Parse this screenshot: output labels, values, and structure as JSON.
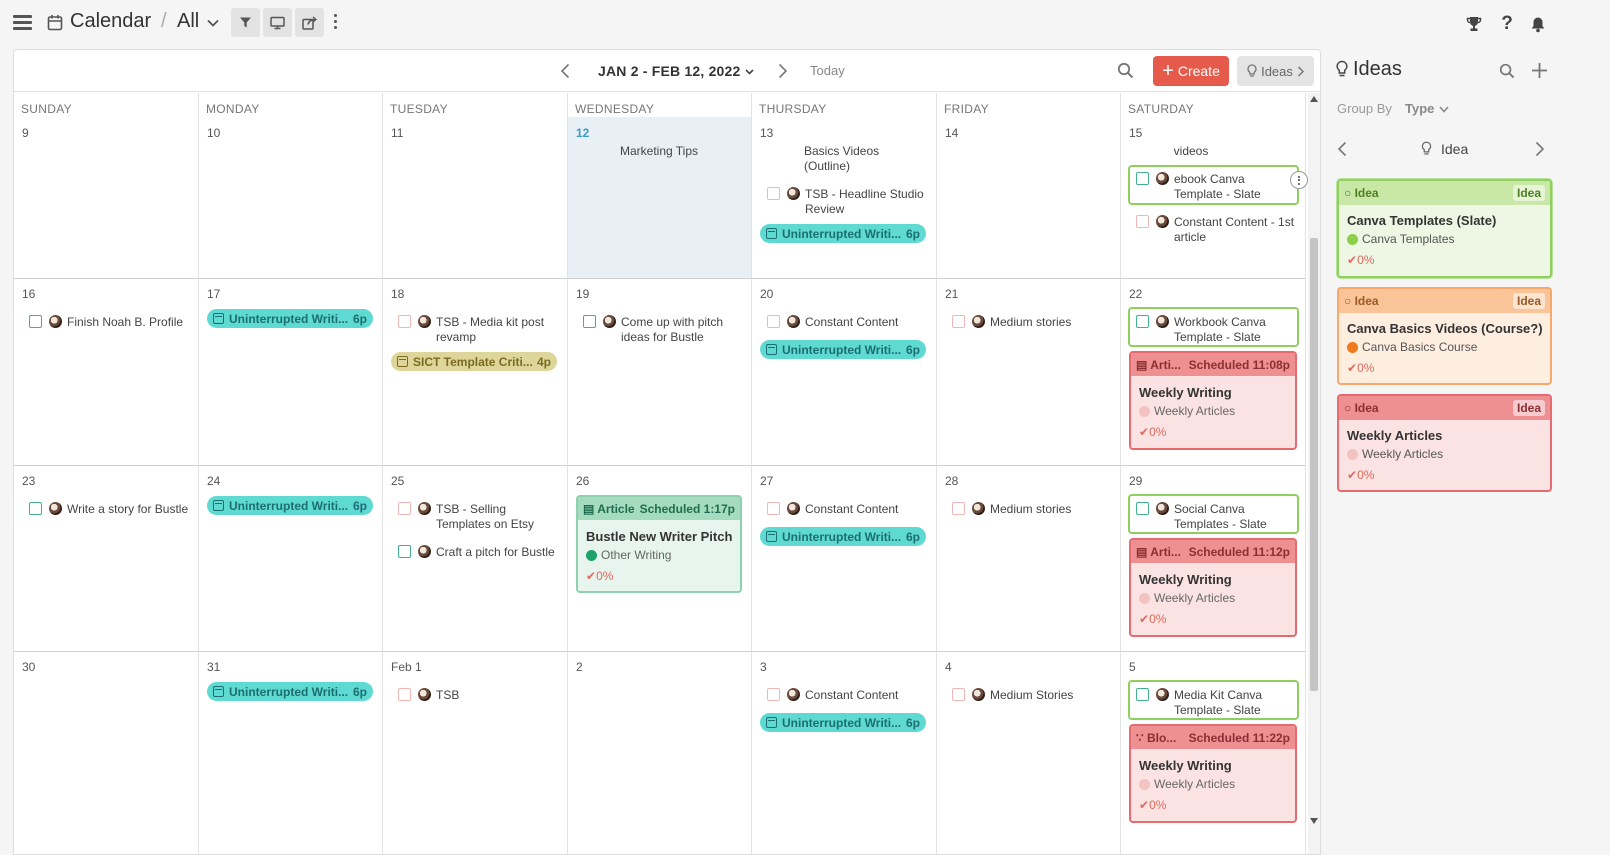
{
  "header": {
    "title": "Calendar",
    "separator": "/",
    "view": "All"
  },
  "toolbar": {
    "range": "JAN 2 - FEB 12, 2022",
    "today": "Today",
    "create": "Create",
    "ideas": "Ideas"
  },
  "days": [
    "SUNDAY",
    "MONDAY",
    "TUESDAY",
    "WEDNESDAY",
    "THURSDAY",
    "FRIDAY",
    "SATURDAY"
  ],
  "weeks": [
    [
      "9",
      "10",
      "11",
      "12",
      "13",
      "14",
      "15"
    ],
    [
      "16",
      "17",
      "18",
      "19",
      "20",
      "21",
      "22"
    ],
    [
      "23",
      "24",
      "25",
      "26",
      "27",
      "28",
      "29"
    ],
    [
      "30",
      "31",
      "Feb 1",
      "2",
      "3",
      "4",
      "5"
    ]
  ],
  "items": {
    "marketing_tips": "Marketing Tips",
    "basics_videos": "Basics Videos (Outline)",
    "tsb_headline": "TSB - Headline Studio Review",
    "uninterrupted": "Uninterrupted Writi...",
    "uninterrupted_time": "6p",
    "videos": "videos",
    "ebook_canva": "ebook Canva Template - Slate",
    "constant_1st": "Constant Content - 1st article",
    "finish_noah": "Finish Noah B. Profile",
    "tsb_media": "TSB - Media kit post revamp",
    "sict": "SICT Template Criti...",
    "sict_time": "4p",
    "come_up": "Come up with pitch ideas for Bustle",
    "constant": "Constant Content",
    "medium": "Medium stories",
    "medium_cap": "Medium Stories",
    "workbook": "Workbook Canva Template - Slate",
    "write_story": "Write a story for Bustle",
    "tsb_selling": "TSB - Selling Templates on Etsy",
    "craft_pitch": "Craft a pitch for Bustle",
    "social": "Social Canva Templates - Slate",
    "tsb": "TSB",
    "media_kit": "Media Kit Canva Template - Slate"
  },
  "cards": {
    "arti_type": "Arti...",
    "blo_type": "Blo...",
    "article_type": "Article",
    "sched_1108": "Scheduled 11:08p",
    "sched_1112": "Scheduled 11:12p",
    "sched_1122": "Scheduled 11:22p",
    "sched_117": "Scheduled 1:17p",
    "weekly_writing": "Weekly Writing",
    "weekly_articles": "Weekly Articles",
    "bustle_pitch": "Bustle New Writer Pitch",
    "other_writing": "Other Writing",
    "progress": "0%"
  },
  "sidebar": {
    "title": "Ideas",
    "group_by_label": "Group By",
    "group_by_value": "Type",
    "nav_label": "Idea",
    "ideas": [
      {
        "tag": "Idea",
        "badge": "Idea",
        "title": "Canva Templates (Slate)",
        "sub": "Canva Templates",
        "progress": "0%",
        "color": "#8fcf5f"
      },
      {
        "tag": "Idea",
        "badge": "Idea",
        "title": "Canva Basics Videos (Course?)",
        "sub": "Canva Basics Course",
        "progress": "0%",
        "color": "#f7a86a"
      },
      {
        "tag": "Idea",
        "badge": "Idea",
        "title": "Weekly Articles",
        "sub": "Weekly Articles",
        "progress": "0%",
        "color": "#e66b70"
      }
    ]
  },
  "colors": {
    "accent": "#e55a4a",
    "teal": "#5fdad2",
    "green_outline": "#8fcf5f",
    "red_card": "#e66b70"
  }
}
